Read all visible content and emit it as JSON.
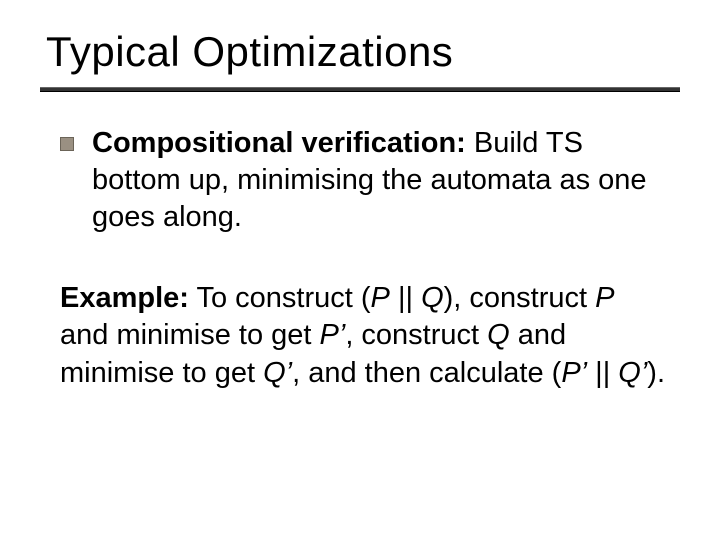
{
  "title": "Typical Optimizations",
  "bullet": {
    "lead": "Compositional verification:",
    "rest": " Build TS bottom up, minimising the automata as one goes along."
  },
  "example": {
    "label": "Example:",
    "line1_a": " To construct (",
    "line1_P": "P",
    "line1_b": " || ",
    "line1_Q": "Q",
    "line1_c": "), construct ",
    "line2_P": "P",
    "line2_a": " and minimise to get ",
    "line2_Pp": "P’",
    "line2_b": ", construct ",
    "line3_Q": "Q",
    "line3_a": " and minimise to get ",
    "line3_Qp": "Q’",
    "line3_b": ", and then calculate (",
    "line4_Pp": "P’",
    "line4_a": " || ",
    "line4_Qp": "Q’",
    "line4_b": ")."
  }
}
